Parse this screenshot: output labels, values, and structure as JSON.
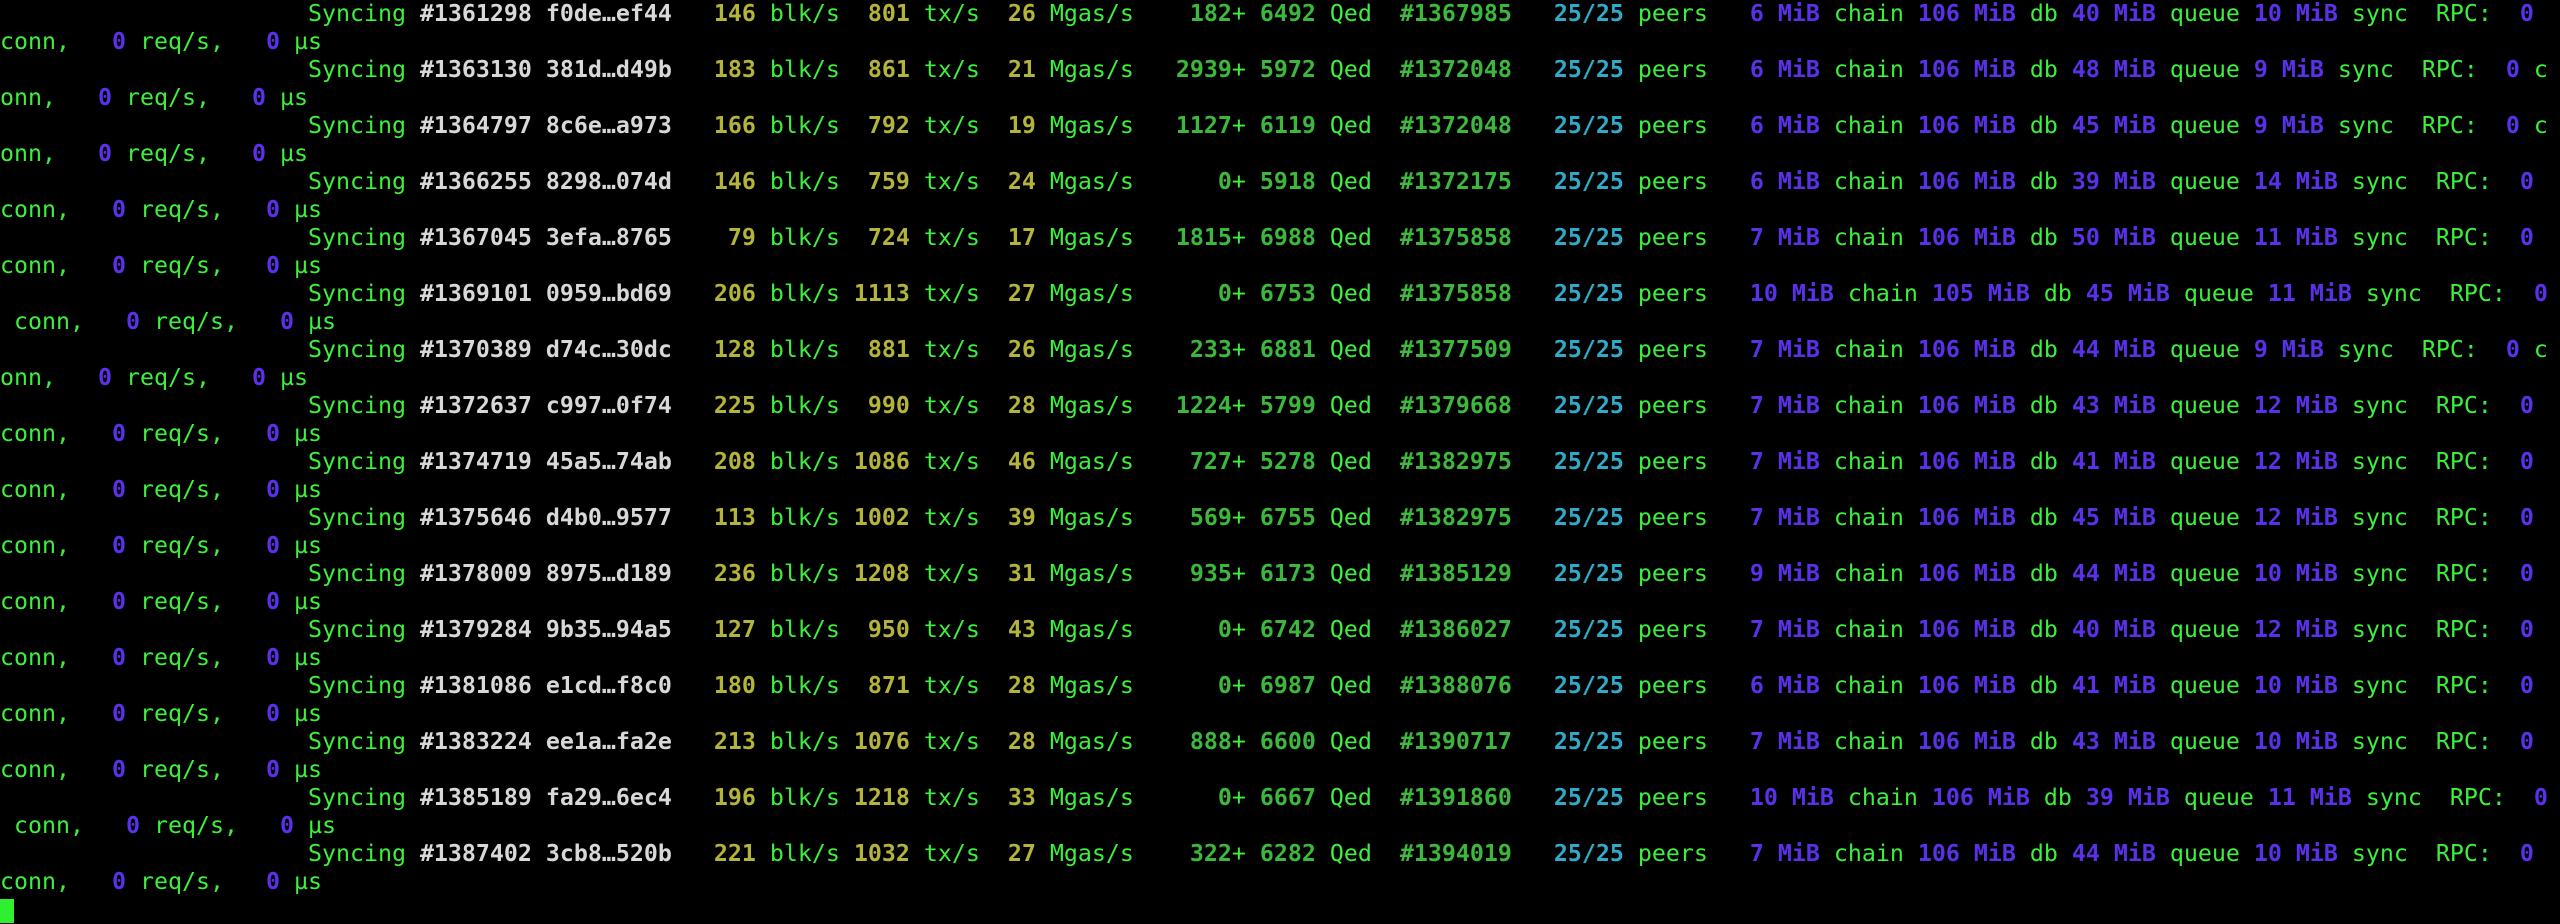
{
  "labels": {
    "syncing": "Syncing",
    "blk": "blk/s",
    "tx": "tx/s",
    "mgas": "Mgas/s",
    "plus": "+",
    "qed": "Qed",
    "peers": "peers",
    "mib": "MiB",
    "chain": "chain",
    "db": "db",
    "queue": "queue",
    "sync": "sync",
    "rpc": "RPC:",
    "conn": "conn,",
    "req": "req/s,",
    "us": "µs"
  },
  "colors": {
    "text": "#3cf03c",
    "hash": "#d8d8d8",
    "rate": "#b4b43a",
    "queue": "#3cb83c",
    "peers": "#30aac8",
    "mem": "#5a30e8",
    "cursor": "#2ef02e"
  },
  "rows": [
    {
      "block": "#1361298",
      "hash": "f0de…ef44",
      "blk": "146",
      "tx": "801",
      "mgas": "26",
      "queued": "182",
      "qed": "6492",
      "best": "#1367985",
      "peers": "25/25",
      "chain": "6",
      "db": "106",
      "queue": "40",
      "sync": "10",
      "conn": "0",
      "req": "0",
      "us": "0"
    },
    {
      "block": "#1363130",
      "hash": "381d…d49b",
      "blk": "183",
      "tx": "861",
      "mgas": "21",
      "queued": "2939",
      "qed": "5972",
      "best": "#1372048",
      "peers": "25/25",
      "chain": "6",
      "db": "106",
      "queue": "48",
      "sync": "9",
      "conn": "0",
      "req": "0",
      "us": "0"
    },
    {
      "block": "#1364797",
      "hash": "8c6e…a973",
      "blk": "166",
      "tx": "792",
      "mgas": "19",
      "queued": "1127",
      "qed": "6119",
      "best": "#1372048",
      "peers": "25/25",
      "chain": "6",
      "db": "106",
      "queue": "45",
      "sync": "9",
      "conn": "0",
      "req": "0",
      "us": "0"
    },
    {
      "block": "#1366255",
      "hash": "8298…074d",
      "blk": "146",
      "tx": "759",
      "mgas": "24",
      "queued": "0",
      "qed": "5918",
      "best": "#1372175",
      "peers": "25/25",
      "chain": "6",
      "db": "106",
      "queue": "39",
      "sync": "14",
      "conn": "0",
      "req": "0",
      "us": "0"
    },
    {
      "block": "#1367045",
      "hash": "3efa…8765",
      "blk": "79",
      "tx": "724",
      "mgas": "17",
      "queued": "1815",
      "qed": "6988",
      "best": "#1375858",
      "peers": "25/25",
      "chain": "7",
      "db": "106",
      "queue": "50",
      "sync": "11",
      "conn": "0",
      "req": "0",
      "us": "0"
    },
    {
      "block": "#1369101",
      "hash": "0959…bd69",
      "blk": "206",
      "tx": "1113",
      "mgas": "27",
      "queued": "0",
      "qed": "6753",
      "best": "#1375858",
      "peers": "25/25",
      "chain": "10",
      "db": "105",
      "queue": "45",
      "sync": "11",
      "conn": "0",
      "req": "0",
      "us": "0"
    },
    {
      "block": "#1370389",
      "hash": "d74c…30dc",
      "blk": "128",
      "tx": "881",
      "mgas": "26",
      "queued": "233",
      "qed": "6881",
      "best": "#1377509",
      "peers": "25/25",
      "chain": "7",
      "db": "106",
      "queue": "44",
      "sync": "9",
      "conn": "0",
      "req": "0",
      "us": "0"
    },
    {
      "block": "#1372637",
      "hash": "c997…0f74",
      "blk": "225",
      "tx": "990",
      "mgas": "28",
      "queued": "1224",
      "qed": "5799",
      "best": "#1379668",
      "peers": "25/25",
      "chain": "7",
      "db": "106",
      "queue": "43",
      "sync": "12",
      "conn": "0",
      "req": "0",
      "us": "0"
    },
    {
      "block": "#1374719",
      "hash": "45a5…74ab",
      "blk": "208",
      "tx": "1086",
      "mgas": "46",
      "queued": "727",
      "qed": "5278",
      "best": "#1382975",
      "peers": "25/25",
      "chain": "7",
      "db": "106",
      "queue": "41",
      "sync": "12",
      "conn": "0",
      "req": "0",
      "us": "0"
    },
    {
      "block": "#1375646",
      "hash": "d4b0…9577",
      "blk": "113",
      "tx": "1002",
      "mgas": "39",
      "queued": "569",
      "qed": "6755",
      "best": "#1382975",
      "peers": "25/25",
      "chain": "7",
      "db": "106",
      "queue": "45",
      "sync": "12",
      "conn": "0",
      "req": "0",
      "us": "0"
    },
    {
      "block": "#1378009",
      "hash": "8975…d189",
      "blk": "236",
      "tx": "1208",
      "mgas": "31",
      "queued": "935",
      "qed": "6173",
      "best": "#1385129",
      "peers": "25/25",
      "chain": "9",
      "db": "106",
      "queue": "44",
      "sync": "10",
      "conn": "0",
      "req": "0",
      "us": "0"
    },
    {
      "block": "#1379284",
      "hash": "9b35…94a5",
      "blk": "127",
      "tx": "950",
      "mgas": "43",
      "queued": "0",
      "qed": "6742",
      "best": "#1386027",
      "peers": "25/25",
      "chain": "7",
      "db": "106",
      "queue": "40",
      "sync": "12",
      "conn": "0",
      "req": "0",
      "us": "0"
    },
    {
      "block": "#1381086",
      "hash": "e1cd…f8c0",
      "blk": "180",
      "tx": "871",
      "mgas": "28",
      "queued": "0",
      "qed": "6987",
      "best": "#1388076",
      "peers": "25/25",
      "chain": "6",
      "db": "106",
      "queue": "41",
      "sync": "10",
      "conn": "0",
      "req": "0",
      "us": "0"
    },
    {
      "block": "#1383224",
      "hash": "ee1a…fa2e",
      "blk": "213",
      "tx": "1076",
      "mgas": "28",
      "queued": "888",
      "qed": "6600",
      "best": "#1390717",
      "peers": "25/25",
      "chain": "7",
      "db": "106",
      "queue": "43",
      "sync": "10",
      "conn": "0",
      "req": "0",
      "us": "0"
    },
    {
      "block": "#1385189",
      "hash": "fa29…6ec4",
      "blk": "196",
      "tx": "1218",
      "mgas": "33",
      "queued": "0",
      "qed": "6667",
      "best": "#1391860",
      "peers": "25/25",
      "chain": "10",
      "db": "106",
      "queue": "39",
      "sync": "11",
      "conn": "0",
      "req": "0",
      "us": "0"
    },
    {
      "block": "#1387402",
      "hash": "3cb8…520b",
      "blk": "221",
      "tx": "1032",
      "mgas": "27",
      "queued": "322",
      "qed": "6282",
      "best": "#1394019",
      "peers": "25/25",
      "chain": "7",
      "db": "106",
      "queue": "44",
      "sync": "10",
      "conn": "0",
      "req": "0",
      "us": "0"
    }
  ]
}
